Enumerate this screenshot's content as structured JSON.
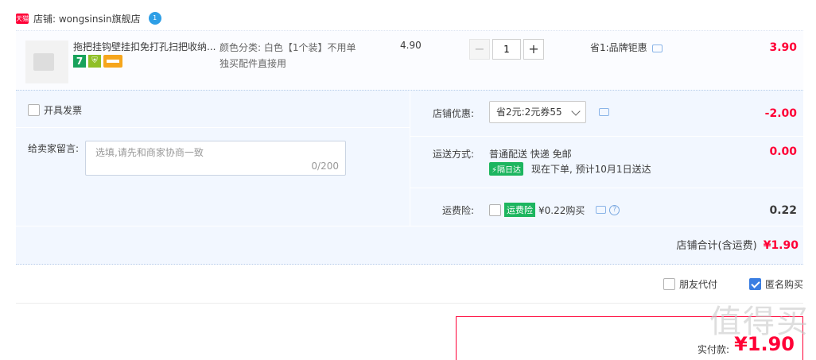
{
  "shop": {
    "badge": "天猫",
    "label": "店铺: wongsinsin旗舰店",
    "ww_badge": "1"
  },
  "item": {
    "title": "拖把挂钩壁挂扣免打孔扫把收纳...",
    "icon_7": "7",
    "icon_shield": "⛨",
    "sku_line1": "颜色分类: 白色【1个装】不用单",
    "sku_line2": "独买配件直接用",
    "unit_price": "4.90",
    "minus": "−",
    "quantity": "1",
    "plus": "+",
    "promo": "省1:品牌钜惠",
    "total": "3.90"
  },
  "options": {
    "invoice_label": "开具发票",
    "message_label": "给卖家留言:",
    "message_placeholder": "选填,请先和商家协商一致",
    "message_count": "0/200",
    "coupon_label": "店铺优惠:",
    "coupon_value": "省2元:2元券55",
    "coupon_amount": "-2.00",
    "shipping_label": "运送方式:",
    "shipping_method": "普通配送 快递 免邮",
    "shipping_tag": "⚡隔日达",
    "shipping_eta": "现在下单, 预计10月1日送达",
    "shipping_amount": "0.00",
    "insurance_label": "运费险:",
    "insurance_tag": "运费险",
    "insurance_text": "¥0.22购买",
    "insurance_help": "?",
    "insurance_amount": "0.22"
  },
  "shop_total": {
    "label": "店铺合计(含运费)",
    "value": "¥1.90"
  },
  "extra": {
    "friend_pay": "朋友代付",
    "anonymous": "匿名购买"
  },
  "payment": {
    "label": "实付款:",
    "amount": "¥1.90"
  },
  "watermark": "值得买",
  "colors": {
    "accent": "#ff0036",
    "panel_bg": "#f2f7ff",
    "checkbox_checked": "#3a7ee2",
    "green_tag": "#1db55f"
  }
}
